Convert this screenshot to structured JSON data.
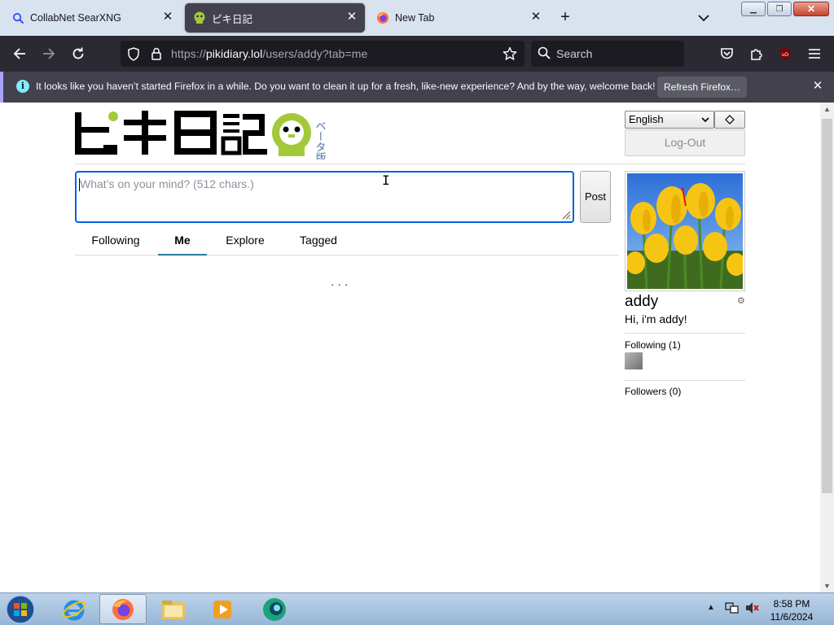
{
  "browser": {
    "tabs": [
      {
        "title": "CollabNet SearXNG",
        "favicon": "magnifier-icon"
      },
      {
        "title": "ピキ日記",
        "favicon": "pikidiary-icon",
        "active": true
      },
      {
        "title": "New Tab",
        "favicon": "firefox-icon"
      }
    ],
    "url": {
      "scheme": "https://",
      "host": "pikidiary.lol",
      "path": "/users/addy?tab=me"
    },
    "search_placeholder": "Search",
    "notification": {
      "message": "It looks like you haven’t started Firefox in a while. Do you want to clean it up for a fresh, like-new experience? And by the way, welcome back!",
      "button": "Refresh Firefox…"
    }
  },
  "site": {
    "logo_text": "ピキ日記",
    "logo_badge": "ベータ版2",
    "language": "English",
    "logout_label": "Log-Out",
    "compose_placeholder": "What’s on your mind? (512 chars.)",
    "post_label": "Post",
    "tabs": [
      "Following",
      "Me",
      "Explore",
      "Tagged"
    ],
    "active_tab": "Me",
    "loading_text": "...",
    "profile": {
      "username": "addy",
      "bio": "Hi, i'm addy!",
      "following_label": "Following (1)",
      "followers_label": "Followers (0)"
    }
  },
  "taskbar": {
    "time": "8:58 PM",
    "date": "11/6/2024"
  },
  "colors": {
    "accent": "#0060df",
    "logo_green": "#a3c93a",
    "tab_underline": "#2a7b9b"
  }
}
